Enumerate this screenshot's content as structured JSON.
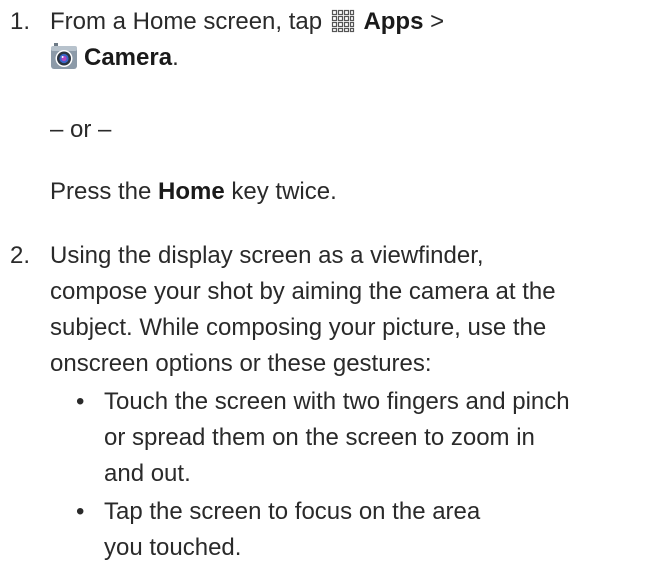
{
  "step1": {
    "number": "1.",
    "line1_prefix": "From a Home screen, tap ",
    "apps_icon": "apps-grid-icon",
    "apps_label": "Apps",
    "separator": " >",
    "camera_icon": "camera-app-icon",
    "camera_label": "Camera",
    "camera_suffix": ".",
    "or_text": "– or –",
    "press_prefix": "Press the ",
    "home_label": "Home",
    "press_suffix": " key twice."
  },
  "step2": {
    "number": "2.",
    "lines": [
      "Using the display screen as a viewfinder,",
      "compose your shot by aiming the camera at the",
      "subject. While composing your picture, use the",
      "onscreen options or these gestures:"
    ],
    "bullets": [
      {
        "lines": [
          "Touch the screen with two fingers and pinch",
          "or spread them on the screen to zoom in",
          "and out."
        ]
      },
      {
        "lines": [
          "Tap the screen to focus on the area",
          "you touched."
        ]
      }
    ]
  },
  "bullet_glyph": "•"
}
